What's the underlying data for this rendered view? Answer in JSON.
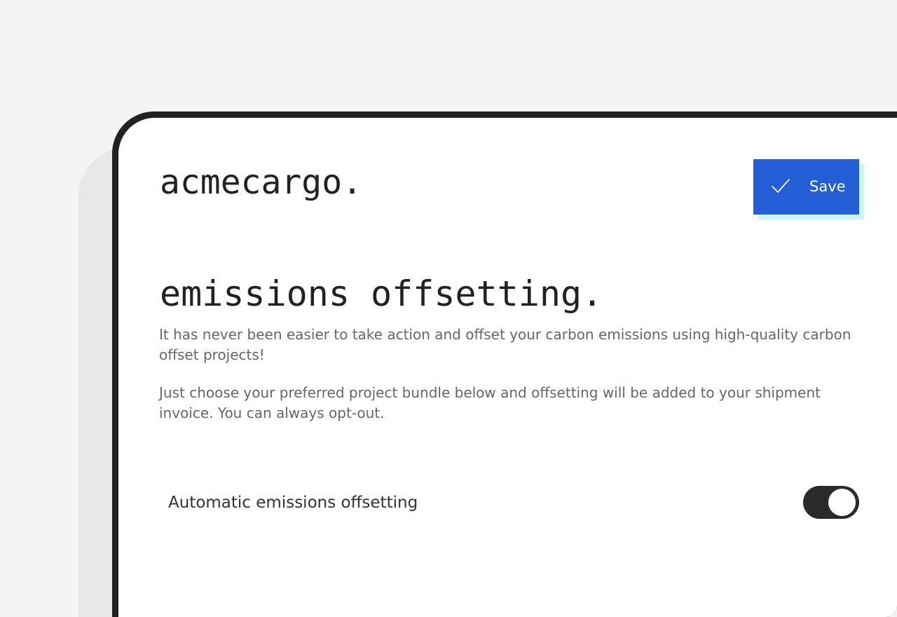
{
  "brand": {
    "logo_text": "acmecargo."
  },
  "toolbar": {
    "save_label": "Save"
  },
  "page": {
    "title": "emissions offsetting.",
    "intro_paragraphs": [
      "It has never been easier to take action and offset your carbon emissions using high-quality carbon offset projects!",
      "Just choose your preferred project bundle below and offsetting will be added to your shipment invoice. You can always opt-out."
    ]
  },
  "settings": {
    "auto_offset": {
      "label": "Automatic emissions offsetting",
      "enabled": true
    }
  },
  "icons": {
    "save": "check-icon"
  },
  "colors": {
    "accent": "#245ed7",
    "accent_shadow": "#c6f8fb",
    "toggle_on": "#2a2a2a",
    "text_primary": "#222222",
    "text_secondary": "#666666"
  }
}
